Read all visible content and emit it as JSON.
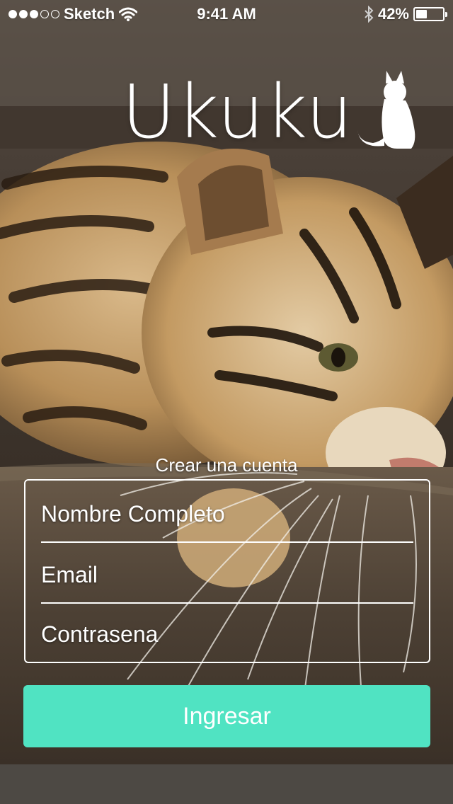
{
  "status_bar": {
    "carrier": "Sketch",
    "signal_bars_filled": 3,
    "signal_bars_total": 5,
    "time": "9:41 AM",
    "battery_text": "42%",
    "battery_level": 0.42,
    "icons": [
      "wifi-icon",
      "bluetooth-icon",
      "battery-icon"
    ]
  },
  "logo": {
    "text": "Ukuku",
    "icon": "cat-icon"
  },
  "form": {
    "caption": "Crear una cuenta",
    "name_placeholder": "Nombre Completo",
    "email_placeholder": "Email",
    "password_placeholder": "Contrasena",
    "submit_label": "Ingresar"
  },
  "colors": {
    "accent": "#50E3C2",
    "text": "#FFFFFF"
  }
}
